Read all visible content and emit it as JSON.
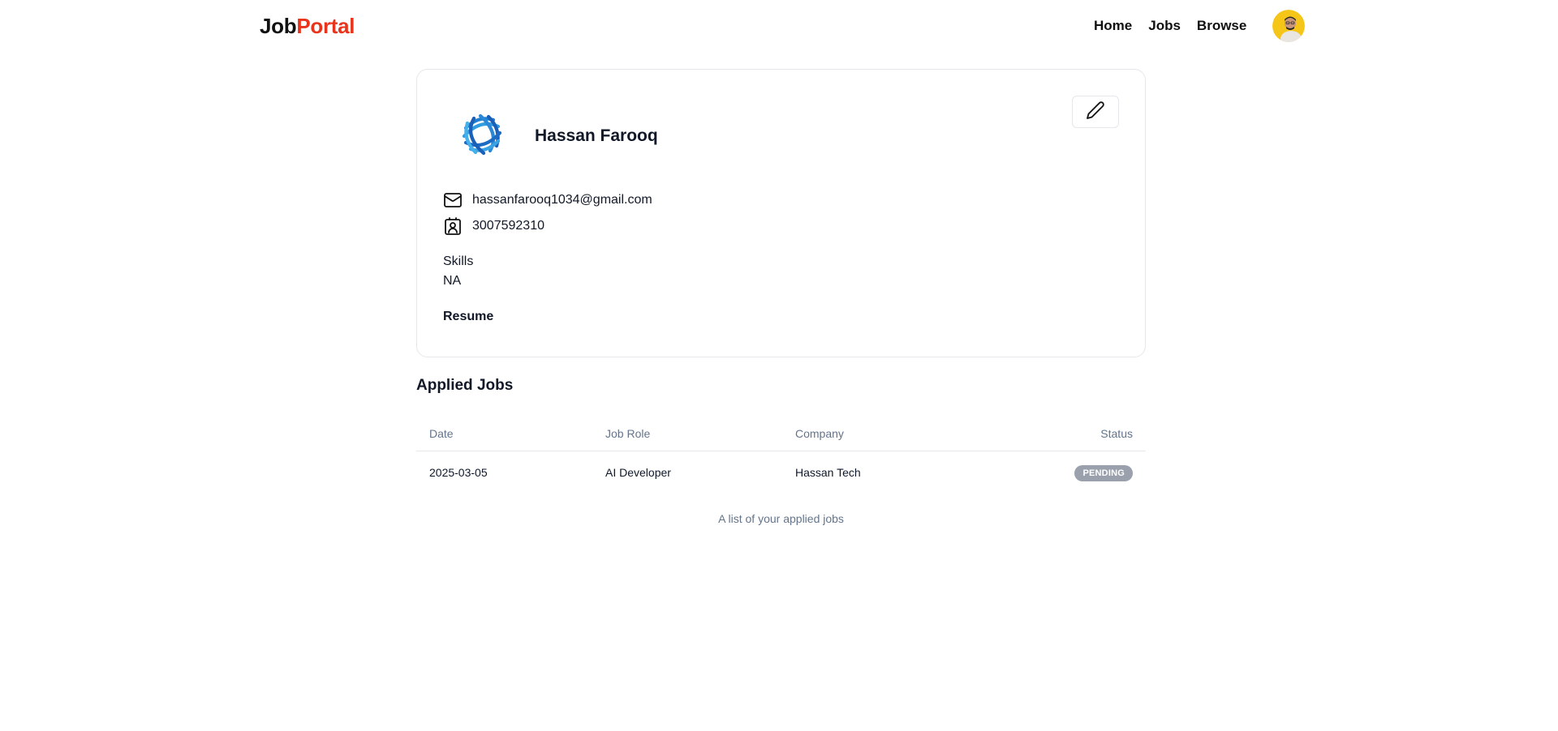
{
  "navbar": {
    "logo_part1": "Job",
    "logo_part2": "Portal",
    "links": [
      "Home",
      "Jobs",
      "Browse"
    ]
  },
  "profile": {
    "name": "Hassan Farooq",
    "email": "hassanfarooq1034@gmail.com",
    "phone": "3007592310",
    "skills_label": "Skills",
    "skills_value": "NA",
    "resume_label": "Resume"
  },
  "applied_jobs": {
    "title": "Applied Jobs",
    "columns": [
      "Date",
      "Job Role",
      "Company",
      "Status"
    ],
    "rows": [
      {
        "date": "2025-03-05",
        "role": "AI Developer",
        "company": "Hassan Tech",
        "status": "PENDING"
      }
    ],
    "caption": "A list of your applied jobs"
  },
  "colors": {
    "brand_accent": "#e8341c",
    "status_pending": "#9aa0ac"
  },
  "icons": [
    "pencil-icon",
    "mail-icon",
    "contact-icon",
    "company-logo",
    "user-avatar"
  ]
}
